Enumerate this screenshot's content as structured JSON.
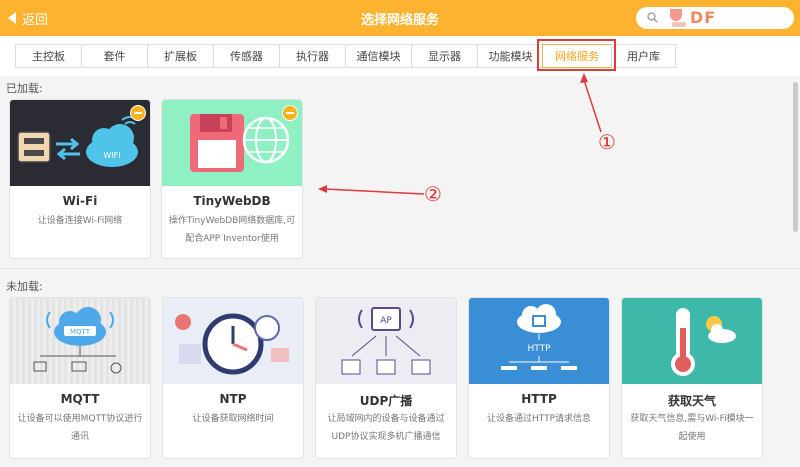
{
  "header": {
    "back_label": "返回",
    "title": "选择网络服务",
    "search_placeholder": "",
    "logo_text": "DF",
    "bg_color": "#fdb32f"
  },
  "tabs": [
    {
      "label": "主控板"
    },
    {
      "label": "套件"
    },
    {
      "label": "扩展板"
    },
    {
      "label": "传感器"
    },
    {
      "label": "执行器"
    },
    {
      "label": "通信模块"
    },
    {
      "label": "显示器"
    },
    {
      "label": "功能模块"
    },
    {
      "label": "网络服务",
      "active": true
    },
    {
      "label": "用户库"
    }
  ],
  "loaded_section": {
    "label": "已加载:",
    "cards": [
      {
        "name": "Wi-Fi",
        "desc": "让设备连接Wi-Fi网络",
        "icon": "wifi-module-icon"
      },
      {
        "name": "TinyWebDB",
        "desc": "操作TinyWebDB网络数据库,可配合APP Inventor使用",
        "icon": "save-globe-icon"
      }
    ]
  },
  "unloaded_section": {
    "label": "未加载:",
    "cards": [
      {
        "name": "MQTT",
        "desc": "让设备可以使用MQTT协议进行通讯",
        "icon": "mqtt-cloud-icon"
      },
      {
        "name": "NTP",
        "desc": "让设备获取网络时间",
        "icon": "clock-icon"
      },
      {
        "name": "UDP广播",
        "desc": "让局域网内的设备与设备通过UDP协议实现多机广播通信",
        "icon": "access-point-icon"
      },
      {
        "name": "HTTP",
        "desc": "让设备通过HTTP请求信息",
        "icon": "http-cloud-icon",
        "img_text": "HTTP"
      },
      {
        "name": "获取天气",
        "desc": "获取天气信息,需与Wi-Fi模块一起使用",
        "icon": "thermometer-icon"
      }
    ]
  },
  "annotations": {
    "marker_1": "①",
    "marker_2": "②"
  },
  "accent_color": "#f5a623",
  "annotation_color": "#e03a3a"
}
